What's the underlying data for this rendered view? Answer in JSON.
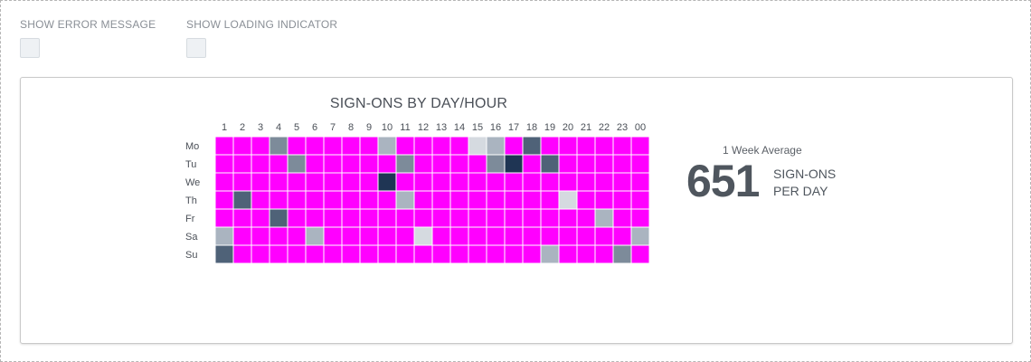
{
  "controls": {
    "show_error_label": "SHOW ERROR MESSAGE",
    "show_loading_label": "SHOW LOADING INDICATOR"
  },
  "card": {
    "title": "SIGN-ONS BY DAY/HOUR",
    "stat_caption": "1 Week Average",
    "stat_value": "651",
    "stat_unit_line1": "SIGN-ONS",
    "stat_unit_line2": "PER DAY"
  },
  "colors": {
    "default_cell": "#ff00ff",
    "gray_scale": {
      "1": "#d5dae0",
      "2": "#aab4c0",
      "3": "#7d8b9a",
      "4": "#4f6278",
      "5": "#1f3554"
    }
  },
  "chart_data": {
    "type": "heatmap",
    "title": "SIGN-ONS BY DAY/HOUR",
    "x": [
      "1",
      "2",
      "3",
      "4",
      "5",
      "6",
      "7",
      "8",
      "9",
      "10",
      "11",
      "12",
      "13",
      "14",
      "15",
      "16",
      "17",
      "18",
      "19",
      "20",
      "21",
      "22",
      "23",
      "00"
    ],
    "y": [
      "Mo",
      "Tu",
      "We",
      "Th",
      "Fr",
      "Sa",
      "Su"
    ],
    "values": [
      [
        0,
        0,
        0,
        3,
        0,
        0,
        0,
        0,
        0,
        2,
        0,
        0,
        0,
        0,
        1,
        2,
        0,
        4,
        0,
        0,
        0,
        0,
        0,
        0
      ],
      [
        0,
        0,
        0,
        0,
        3,
        0,
        0,
        0,
        0,
        0,
        3,
        0,
        0,
        0,
        0,
        3,
        5,
        0,
        4,
        0,
        0,
        0,
        0,
        0
      ],
      [
        0,
        0,
        0,
        0,
        0,
        0,
        0,
        0,
        0,
        5,
        0,
        0,
        0,
        0,
        0,
        0,
        0,
        0,
        0,
        0,
        0,
        0,
        0,
        0
      ],
      [
        0,
        4,
        0,
        0,
        0,
        0,
        0,
        0,
        0,
        0,
        2,
        0,
        0,
        0,
        0,
        0,
        0,
        0,
        0,
        1,
        0,
        0,
        0,
        0
      ],
      [
        0,
        0,
        0,
        4,
        0,
        0,
        0,
        0,
        0,
        0,
        0,
        0,
        0,
        0,
        0,
        0,
        0,
        0,
        0,
        0,
        0,
        2,
        0,
        0
      ],
      [
        2,
        0,
        0,
        0,
        0,
        2,
        0,
        0,
        0,
        0,
        0,
        1,
        0,
        0,
        0,
        0,
        0,
        0,
        0,
        0,
        0,
        0,
        0,
        2
      ],
      [
        4,
        0,
        0,
        0,
        0,
        0,
        0,
        0,
        0,
        0,
        0,
        0,
        0,
        0,
        0,
        0,
        0,
        0,
        2,
        0,
        0,
        0,
        3,
        0
      ]
    ],
    "legend": "none",
    "grid": true
  }
}
